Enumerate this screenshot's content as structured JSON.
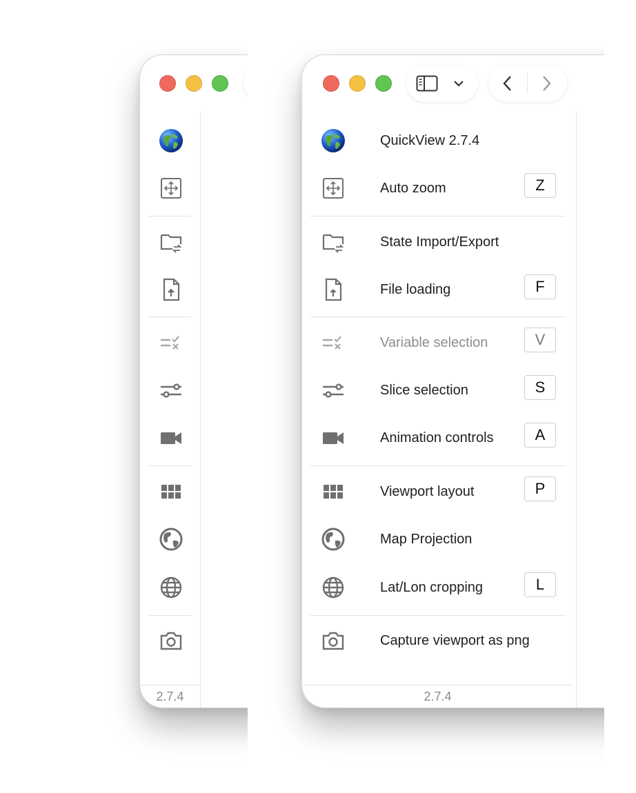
{
  "app": {
    "name_version": "QuickView 2.7.4",
    "version": "2.7.4"
  },
  "toolbar": {
    "toggle_drawer_icon": "sidebar-panel-icon",
    "dropdown_icon": "chevron-down-icon",
    "back_icon": "chevron-left-icon",
    "forward_icon": "chevron-right-icon"
  },
  "nav": {
    "items": [
      {
        "label": "QuickView 2.7.4",
        "icon": "globe-logo-icon",
        "shortcut": ""
      },
      {
        "label": "Auto zoom",
        "icon": "auto-zoom-icon",
        "shortcut": "Z"
      },
      {
        "label": "State Import/Export",
        "icon": "folder-swap-icon",
        "shortcut": ""
      },
      {
        "label": "File loading",
        "icon": "file-upload-icon",
        "shortcut": "F"
      },
      {
        "label": "Variable selection",
        "icon": "list-check-icon",
        "shortcut": "V",
        "disabled": true
      },
      {
        "label": "Slice selection",
        "icon": "tune-icon",
        "shortcut": "S"
      },
      {
        "label": "Animation controls",
        "icon": "video-camera-icon",
        "shortcut": "A"
      },
      {
        "label": "Viewport layout",
        "icon": "grid-icon",
        "shortcut": "P"
      },
      {
        "label": "Map Projection",
        "icon": "earth-icon",
        "shortcut": ""
      },
      {
        "label": "Lat/Lon cropping",
        "icon": "web-globe-icon",
        "shortcut": "L"
      },
      {
        "label": "Capture viewport as png",
        "icon": "camera-icon",
        "shortcut": ""
      }
    ]
  },
  "colors": {
    "close": "#ee6a5f",
    "minimize": "#f5c143",
    "zoom": "#61c454",
    "icon_gray": "#6f6f6f",
    "icon_disabled": "#a8a8a8"
  }
}
